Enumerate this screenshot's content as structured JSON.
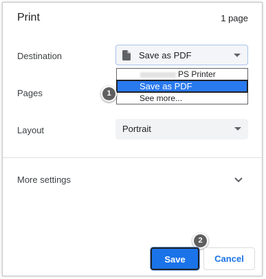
{
  "dialog": {
    "title": "Print",
    "page_count": "1 page"
  },
  "destination": {
    "label": "Destination",
    "selected": "Save as PDF",
    "icon": "document-icon",
    "options": [
      {
        "label": "PS Printer",
        "highlighted": false
      },
      {
        "label": "Save as PDF",
        "highlighted": true
      },
      {
        "label": "See more...",
        "highlighted": false
      }
    ]
  },
  "pages": {
    "label": "Pages"
  },
  "layout": {
    "label": "Layout",
    "selected": "Portrait"
  },
  "more_settings": {
    "label": "More settings",
    "icon": "chevron-down-icon"
  },
  "steps": {
    "step1": "1",
    "step2": "2"
  },
  "buttons": {
    "save": "Save",
    "cancel": "Cancel"
  },
  "colors": {
    "accent": "#1a73e8",
    "highlight": "#2979ef",
    "badge": "#5f5f5f"
  }
}
